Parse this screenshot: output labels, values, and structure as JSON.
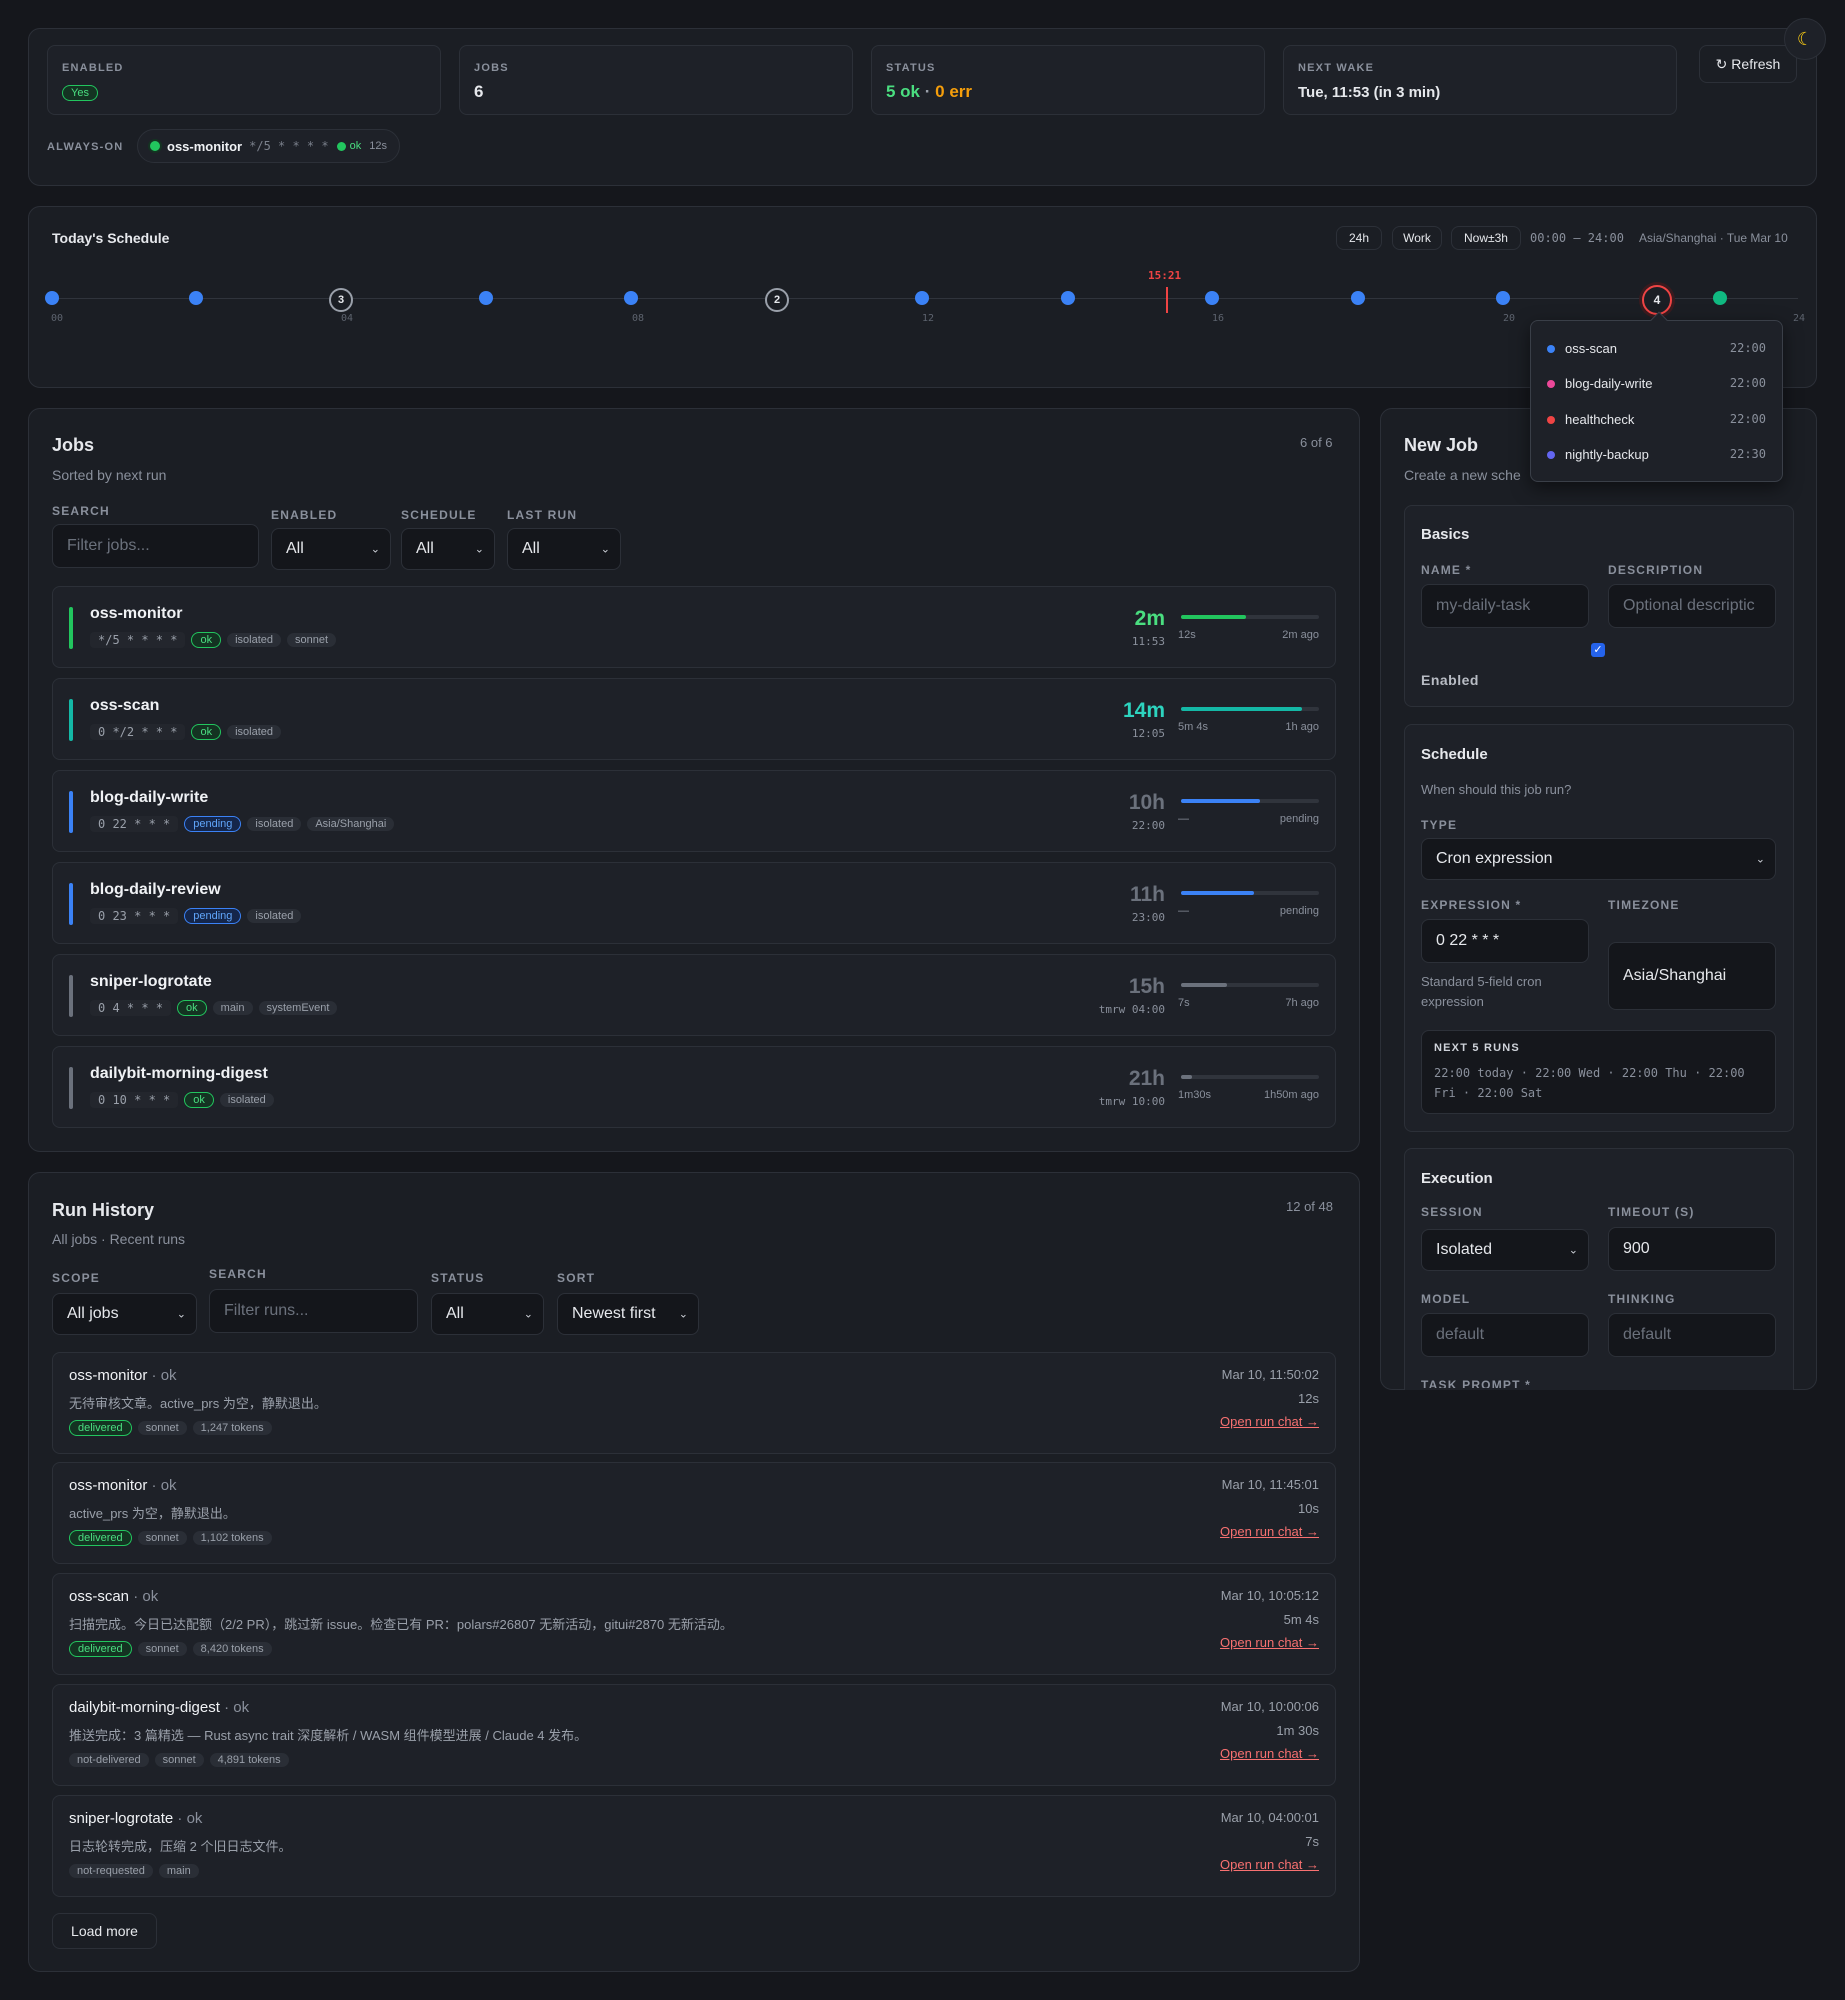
{
  "theme_icon": "moon-icon",
  "header": {
    "enabled_label": "ENABLED",
    "enabled_value": "Yes",
    "jobs_label": "JOBS",
    "jobs_value": "6",
    "status_label": "STATUS",
    "status_ok": "5 ok",
    "status_sep": "·",
    "status_err": "0 err",
    "next_wake_label": "NEXT WAKE",
    "next_wake_value": "Tue, 11:53 (in 3 min)",
    "refresh_label": "↻ Refresh",
    "always_on_label": "ALWAYS-ON",
    "always_on": {
      "name": "oss-monitor",
      "cron": "*/5 * * * *",
      "status": "ok",
      "duration": "12s"
    }
  },
  "schedule": {
    "title": "Today's Schedule",
    "ranges": [
      "24h",
      "Work",
      "Now±3h"
    ],
    "window": "00:00 — 24:00",
    "tz_date": "Asia/Shanghai · Tue Mar 10",
    "now_label": "15:21",
    "ticks": [
      "00",
      "04",
      "08",
      "12",
      "16",
      "20",
      "24"
    ],
    "clusters": [
      "3",
      "2",
      "4"
    ],
    "popover": [
      {
        "name": "oss-scan",
        "time": "22:00",
        "color": "#3b82f6"
      },
      {
        "name": "blog-daily-write",
        "time": "22:00",
        "color": "#ec4899"
      },
      {
        "name": "healthcheck",
        "time": "22:00",
        "color": "#ef4444"
      },
      {
        "name": "nightly-backup",
        "time": "22:30",
        "color": "#6366f1"
      }
    ]
  },
  "jobs": {
    "title": "Jobs",
    "subtitle": "Sorted by next run",
    "count": "6 of 6",
    "search_label": "SEARCH",
    "search_placeholder": "Filter jobs...",
    "enabled_label": "ENABLED",
    "enabled_value": "All",
    "schedule_label": "SCHEDULE",
    "schedule_value": "All",
    "lastrun_label": "LAST RUN",
    "lastrun_value": "All",
    "items": [
      {
        "name": "oss-monitor",
        "cron": "*/5 * * * *",
        "status": "ok",
        "tags": [
          "isolated",
          "sonnet"
        ],
        "in": "2m",
        "at": "11:53",
        "progress": 0.47,
        "left": "12s",
        "right": "2m ago",
        "color": "#22c55e"
      },
      {
        "name": "oss-scan",
        "cron": "0 */2 * * *",
        "status": "ok",
        "tags": [
          "isolated"
        ],
        "in": "14m",
        "at": "12:05",
        "progress": 0.88,
        "left": "5m 4s",
        "right": "1h ago",
        "color": "#14b8a6"
      },
      {
        "name": "blog-daily-write",
        "cron": "0 22 * * *",
        "status": "pending",
        "tags": [
          "isolated",
          "Asia/Shanghai"
        ],
        "in": "10h",
        "at": "22:00",
        "progress": 0.57,
        "left": "—",
        "right": "pending",
        "color": "#3b82f6"
      },
      {
        "name": "blog-daily-review",
        "cron": "0 23 * * *",
        "status": "pending",
        "tags": [
          "isolated"
        ],
        "in": "11h",
        "at": "23:00",
        "progress": 0.53,
        "left": "—",
        "right": "pending",
        "color": "#3b82f6"
      },
      {
        "name": "sniper-logrotate",
        "cron": "0 4 * * *",
        "status": "ok",
        "tags": [
          "main",
          "systemEvent"
        ],
        "in": "15h",
        "at": "tmrw 04:00",
        "progress": 0.33,
        "left": "7s",
        "right": "7h ago",
        "color": "#6b717c"
      },
      {
        "name": "dailybit-morning-digest",
        "cron": "0 10 * * *",
        "status": "ok",
        "tags": [
          "isolated"
        ],
        "in": "21h",
        "at": "tmrw 10:00",
        "progress": 0.08,
        "left": "1m30s",
        "right": "1h50m ago",
        "color": "#6b717c"
      }
    ]
  },
  "runs": {
    "title": "Run History",
    "subtitle": "All jobs · Recent runs",
    "count": "12 of 48",
    "scope_label": "SCOPE",
    "scope_value": "All jobs",
    "search_label": "SEARCH",
    "search_placeholder": "Filter runs...",
    "status_label": "STATUS",
    "status_value": "All",
    "sort_label": "SORT",
    "sort_value": "Newest first",
    "open_chat": "Open run chat →",
    "load_more": "Load more",
    "items": [
      {
        "name": "oss-monitor",
        "status": "· ok",
        "desc": "无待审核文章。active_prs 为空，静默退出。",
        "tags": [
          "delivered",
          "sonnet",
          "1,247 tokens"
        ],
        "time": "Mar 10, 11:50:02",
        "dur": "12s"
      },
      {
        "name": "oss-monitor",
        "status": "· ok",
        "desc": "active_prs 为空，静默退出。",
        "tags": [
          "delivered",
          "sonnet",
          "1,102 tokens"
        ],
        "time": "Mar 10, 11:45:01",
        "dur": "10s"
      },
      {
        "name": "oss-scan",
        "status": "· ok",
        "desc": "扫描完成。今日已达配额（2/2 PR），跳过新 issue。检查已有 PR：polars#26807 无新活动，gitui#2870 无新活动。",
        "tags": [
          "delivered",
          "sonnet",
          "8,420 tokens"
        ],
        "time": "Mar 10, 10:05:12",
        "dur": "5m 4s"
      },
      {
        "name": "dailybit-morning-digest",
        "status": "· ok",
        "desc": "推送完成：3 篇精选 — Rust async trait 深度解析 / WASM 组件模型进展 / Claude 4 发布。",
        "tags": [
          "not-delivered",
          "sonnet",
          "4,891 tokens"
        ],
        "time": "Mar 10, 10:00:06",
        "dur": "1m 30s"
      },
      {
        "name": "sniper-logrotate",
        "status": "· ok",
        "desc": "日志轮转完成，压缩 2 个旧日志文件。",
        "tags": [
          "not-requested",
          "main"
        ],
        "time": "Mar 10, 04:00:01",
        "dur": "7s"
      }
    ]
  },
  "newjob": {
    "title": "New Job",
    "subtitle": "Create a new sche",
    "basics_title": "Basics",
    "name_label": "NAME *",
    "name_placeholder": "my-daily-task",
    "desc_label": "DESCRIPTION",
    "desc_placeholder": "Optional descriptic",
    "enabled_label": "Enabled",
    "schedule_title": "Schedule",
    "schedule_sub": "When should this job run?",
    "type_label": "TYPE",
    "type_value": "Cron expression",
    "expr_label": "EXPRESSION *",
    "expr_value": "0 22 * * *",
    "expr_hint": "Standard 5-field cron expression",
    "tz_label": "TIMEZONE",
    "tz_value": "Asia/Shanghai",
    "next_label": "NEXT 5 RUNS",
    "next_runs": "22:00 today · 22:00 Wed · 22:00 Thu · 22:00 Fri · 22:00 Sat",
    "exec_title": "Execution",
    "session_label": "SESSION",
    "session_value": "Isolated",
    "timeout_label": "TIMEOUT (S)",
    "timeout_value": "900",
    "model_label": "MODEL",
    "model_placeholder": "default",
    "thinking_label": "THINKING",
    "thinking_placeholder": "default",
    "prompt_label": "TASK PROMPT *"
  }
}
